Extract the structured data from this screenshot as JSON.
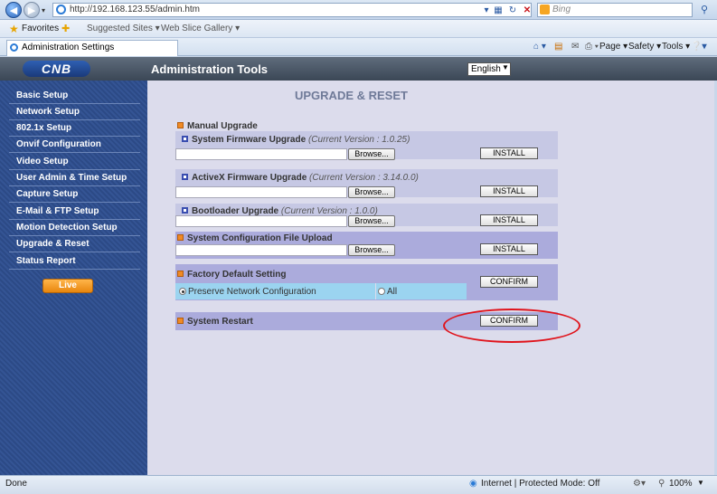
{
  "browser": {
    "address": "http://192.168.123.55/admin.htm",
    "search_placeholder": "Bing",
    "favorites_label": "Favorites",
    "fav_items": [
      "Suggested Sites ▾",
      "Web Slice Gallery ▾"
    ],
    "tab_title": "Administration Settings",
    "commands": [
      "Page ▾",
      "Safety ▾",
      "Tools ▾"
    ],
    "status_left": "Done",
    "status_zone": "Internet | Protected Mode: Off",
    "zoom": "100%"
  },
  "header": {
    "logo": "CNB",
    "title": "Administration Tools",
    "language": "English"
  },
  "sidebar": {
    "items": [
      {
        "label": "Basic Setup"
      },
      {
        "label": "Network Setup"
      },
      {
        "label": "802.1x Setup"
      },
      {
        "label": "Onvif Configuration"
      },
      {
        "label": "Video Setup"
      },
      {
        "label": "User Admin & Time Setup"
      },
      {
        "label": "Capture Setup"
      },
      {
        "label": "E-Mail & FTP Setup"
      },
      {
        "label": "Motion Detection Setup"
      },
      {
        "label": "Upgrade & Reset"
      },
      {
        "label": "Status Report"
      }
    ],
    "live_button": "Live"
  },
  "main": {
    "title": "UPGRADE & RESET",
    "manual_upgrade": "Manual Upgrade",
    "firmware": {
      "label": "System Firmware Upgrade",
      "version": "(Current Version : 1.0.25)"
    },
    "activex": {
      "label": "ActiveX Firmware Upgrade",
      "version": "(Current Version : 3.14.0.0)"
    },
    "bootloader": {
      "label": "Bootloader Upgrade",
      "version": "(Current Version : 1.0.0)"
    },
    "config_upload": "System Configuration File Upload",
    "browse_label": "Browse...",
    "install_label": "INSTALL",
    "factory_default": "Factory Default Setting",
    "preserve_network": "Preserve Network Configuration",
    "all_option": "All",
    "confirm_label": "CONFIRM",
    "system_restart": "System Restart"
  }
}
